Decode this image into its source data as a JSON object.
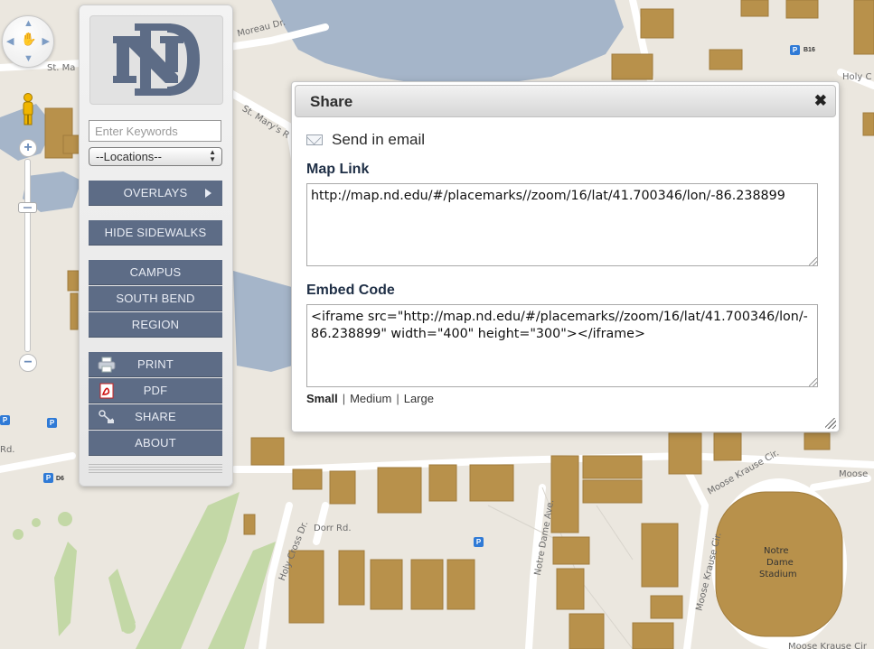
{
  "map": {
    "labels": {
      "moreau": "Moreau Dr.",
      "st_ma": "St. Ma",
      "st_marys": "St. Mary's R",
      "holy_c": "Holy C",
      "dorr": "Dorr Rd.",
      "holy_cross": "Holy Cross Dr.",
      "notre_dame_ave": "Notre Dame Ave.",
      "moose_krause_cir_1": "Moose Krause Cir.",
      "moose_krause_cir_2": "Moose Krause Cir.",
      "moose": "Moose",
      "rd": "Rd.",
      "stadium_1": "Notre",
      "stadium_2": "Dame",
      "stadium_3": "Stadium",
      "moose_krause_bottom": "Moose Krause Cir"
    },
    "parking_glyph": "P",
    "parking_codes": {
      "b16": "B16",
      "d6": "D6"
    },
    "colors": {
      "building": "#b8914b",
      "lake": "#a5b5c9",
      "road": "#ffffff",
      "grass": "#c3d8a6"
    }
  },
  "controls": {
    "zoom_in": "+",
    "zoom_out": "−"
  },
  "sidebar": {
    "search_placeholder": "Enter Keywords",
    "locations_value": "--Locations--",
    "overlays": "OVERLAYS",
    "hide_sidewalks": "HIDE SIDEWALKS",
    "campus": "CAMPUS",
    "south_bend": "SOUTH BEND",
    "region": "REGION",
    "print": "PRINT",
    "pdf": "PDF",
    "share": "SHARE",
    "about": "ABOUT",
    "button_color": "#5d6c86"
  },
  "dialog": {
    "title": "Share",
    "close": "✖",
    "send_email": "Send in email",
    "map_link_label": "Map Link",
    "map_link_value": "http://map.nd.edu/#/placemarks//zoom/16/lat/41.700346/lon/-86.238899",
    "embed_label": "Embed Code",
    "embed_value": "<iframe src=\"http://map.nd.edu/#/placemarks//zoom/16/lat/41.700346/lon/-86.238899\" width=\"400\" height=\"300\"></iframe>",
    "size_small": "Small",
    "size_medium": "Medium",
    "size_large": "Large",
    "separator": "|"
  }
}
